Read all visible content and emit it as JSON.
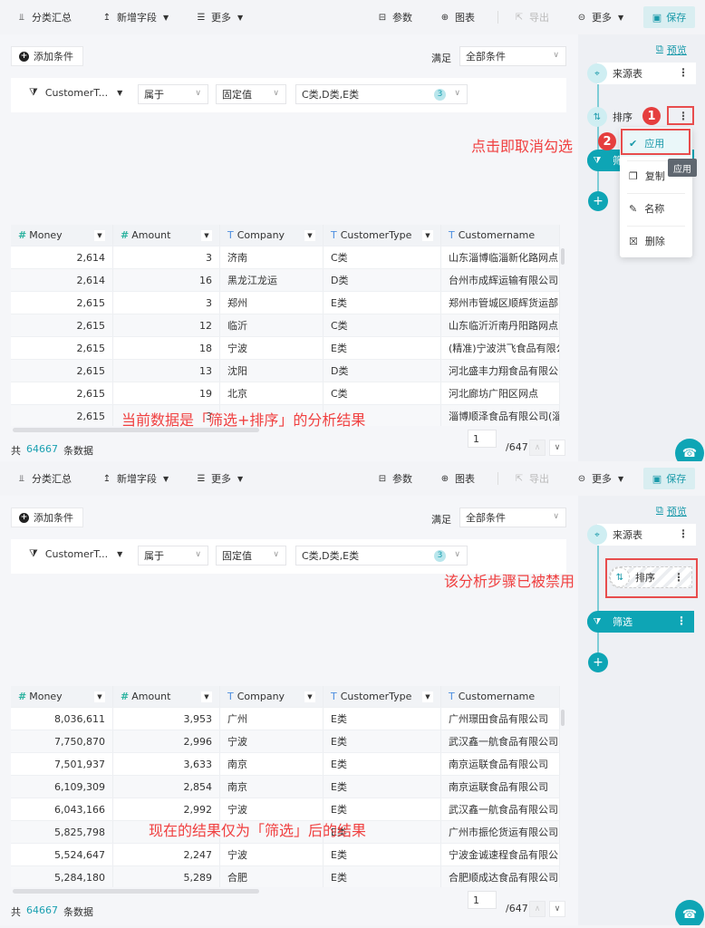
{
  "toolbar": {
    "group_summary": "分类汇总",
    "add_field": "新增字段",
    "more_left": "更多",
    "params": "参数",
    "chart": "图表",
    "export": "导出",
    "more_right": "更多",
    "save": "保存"
  },
  "filter": {
    "add_condition": "添加条件",
    "satisfy_label": "满足",
    "satisfy_value": "全部条件",
    "field": "CustomerT...",
    "operator": "属于",
    "value_type": "固定值",
    "values": "C类,D类,E类",
    "values_count": "3"
  },
  "steps_panel": {
    "preview": "预览",
    "source": "来源表",
    "sort": "排序",
    "filter": "筛选",
    "add": "+"
  },
  "context_menu": {
    "items": [
      {
        "label": "应用",
        "icon": "check-icon",
        "checked": true
      },
      {
        "label": "复制",
        "icon": "copy-icon"
      },
      {
        "label": "名称",
        "icon": "rename-icon"
      },
      {
        "label": "删除",
        "icon": "trash-icon"
      }
    ],
    "tooltip": "应用"
  },
  "columns": [
    {
      "name": "Money",
      "type": "#"
    },
    {
      "name": "Amount",
      "type": "#"
    },
    {
      "name": "Company",
      "type": "T"
    },
    {
      "name": "CustomerType",
      "type": "T"
    },
    {
      "name": "Customername",
      "type": "T"
    }
  ],
  "table1": {
    "rows": [
      [
        "2,614",
        "3",
        "济南",
        "C类",
        "山东淄博临淄新化路网点"
      ],
      [
        "2,614",
        "16",
        "黑龙江龙运",
        "D类",
        "台州市成辉运输有限公司"
      ],
      [
        "2,615",
        "3",
        "郑州",
        "E类",
        "郑州市管城区顺辉货运部"
      ],
      [
        "2,615",
        "12",
        "临沂",
        "C类",
        "山东临沂沂南丹阳路网点"
      ],
      [
        "2,615",
        "18",
        "宁波",
        "E类",
        "(精准)宁波洪飞食品有限公"
      ],
      [
        "2,615",
        "13",
        "沈阳",
        "D类",
        "河北盛丰力翔食品有限公"
      ],
      [
        "2,615",
        "19",
        "北京",
        "C类",
        "河北廊坊广阳区网点"
      ],
      [
        "2,615",
        "3",
        "",
        "",
        "淄博顺泽食品有限公司(淄"
      ]
    ]
  },
  "table2": {
    "rows": [
      [
        "8,036,611",
        "3,953",
        "广州",
        "E类",
        "广州璟田食品有限公司"
      ],
      [
        "7,750,870",
        "2,996",
        "宁波",
        "E类",
        "武汉鑫一航食品有限公司"
      ],
      [
        "7,501,937",
        "3,633",
        "南京",
        "E类",
        "南京运联食品有限公司"
      ],
      [
        "6,109,309",
        "2,854",
        "南京",
        "E类",
        "南京运联食品有限公司"
      ],
      [
        "6,043,166",
        "2,992",
        "宁波",
        "E类",
        "武汉鑫一航食品有限公司"
      ],
      [
        "5,825,798",
        "",
        "",
        "E类",
        "广州市振伦货运有限公司"
      ],
      [
        "5,524,647",
        "2,247",
        "宁波",
        "E类",
        "宁波金诚速程食品有限公"
      ],
      [
        "5,284,180",
        "5,289",
        "合肥",
        "E类",
        "合肥顺成达食品有限公司"
      ]
    ]
  },
  "footer": {
    "prefix": "共",
    "total": "64667",
    "suffix": "条数据",
    "page": "1",
    "page_total": "/647"
  },
  "annotations": {
    "step1": "1",
    "step2": "2",
    "click_uncheck": "点击即取消勾选",
    "current_result": "当前数据是「筛选+排序」的分析结果",
    "step_disabled": "该分析步骤已被禁用",
    "now_result": "现在的结果仅为「筛选」后的结果"
  }
}
